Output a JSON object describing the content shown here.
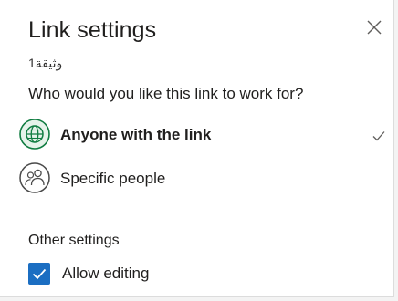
{
  "dialog": {
    "title": "Link settings",
    "filename": "وثيقة1",
    "question": "Who would you like this link to work for?"
  },
  "options": [
    {
      "label": "Anyone with the link",
      "icon": "globe-icon",
      "selected": true
    },
    {
      "label": "Specific people",
      "icon": "people-icon",
      "selected": false
    }
  ],
  "other_settings": {
    "heading": "Other settings",
    "allow_editing_label": "Allow editing",
    "allow_editing_checked": true
  },
  "colors": {
    "accent": "#1b6ec2",
    "globe_green": "#107c41"
  }
}
